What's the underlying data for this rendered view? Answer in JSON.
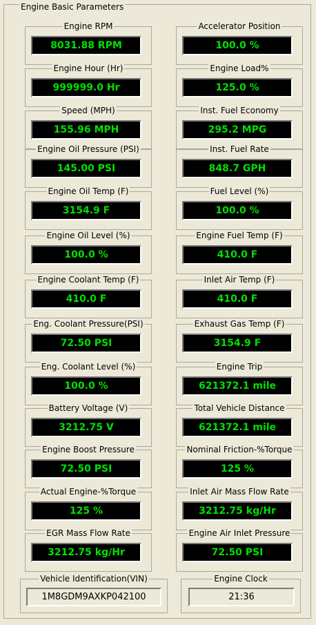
{
  "group_title": "Engine Basic Parameters",
  "panels": [
    {
      "left_title": "Engine RPM",
      "left_value": "8031.88 RPM",
      "right_title": "Accelerator Position",
      "right_value": "100.0 %"
    },
    {
      "left_title": "Engine Hour (Hr)",
      "left_value": "999999.0 Hr",
      "right_title": "Engine Load%",
      "right_value": "125.0 %"
    },
    {
      "left_title": "Speed (MPH)",
      "left_value": "155.96 MPH",
      "right_title": "Inst. Fuel Economy",
      "right_value": "295.2 MPG"
    },
    {
      "left_title": "Engine Oil Pressure (PSI)",
      "left_value": "145.00 PSI",
      "right_title": "Inst. Fuel Rate",
      "right_value": "848.7 GPH"
    },
    {
      "left_title": "Engine Oil Temp (F)",
      "left_value": "3154.9 F",
      "right_title": "Fuel Level (%)",
      "right_value": "100.0 %"
    },
    {
      "left_title": "Engine Oil Level (%)",
      "left_value": "100.0 %",
      "right_title": "Engine Fuel Temp (F)",
      "right_value": "410.0 F"
    },
    {
      "left_title": "Engine Coolant Temp (F)",
      "left_value": "410.0 F",
      "right_title": "Inlet Air Temp (F)",
      "right_value": "410.0 F"
    },
    {
      "left_title": "Eng. Coolant Pressure(PSI)",
      "left_value": "72.50 PSI",
      "right_title": "Exhaust Gas Temp (F)",
      "right_value": "3154.9 F"
    },
    {
      "left_title": "Eng. Coolant Level (%)",
      "left_value": "100.0 %",
      "right_title": "Engine Trip",
      "right_value": "621372.1 mile"
    },
    {
      "left_title": "Battery Voltage (V)",
      "left_value": "3212.75 V",
      "right_title": "Total Vehicle Distance",
      "right_value": "621372.1 mile"
    },
    {
      "left_title": "Engine Boost Pressure",
      "left_value": "72.50 PSI",
      "right_title": "Nominal Friction-%Torque",
      "right_value": "125 %"
    },
    {
      "left_title": "Actual Engine-%Torque",
      "left_value": "125 %",
      "right_title": "Inlet Air Mass Flow Rate",
      "right_value": "3212.75 kg/Hr"
    },
    {
      "left_title": "EGR Mass Flow Rate",
      "left_value": "3212.75 kg/Hr",
      "right_title": "Engine Air Inlet Pressure",
      "right_value": "72.50 PSI"
    }
  ],
  "vin": {
    "title": "Vehicle Identification(VIN)",
    "value": "1M8GDM9AXKP042100"
  },
  "clock": {
    "title": "Engine Clock",
    "value": "21:36"
  },
  "colors": {
    "background": "#ece9d8",
    "display_bg": "#000000",
    "display_text": "#00e000",
    "border": "#aca899"
  }
}
